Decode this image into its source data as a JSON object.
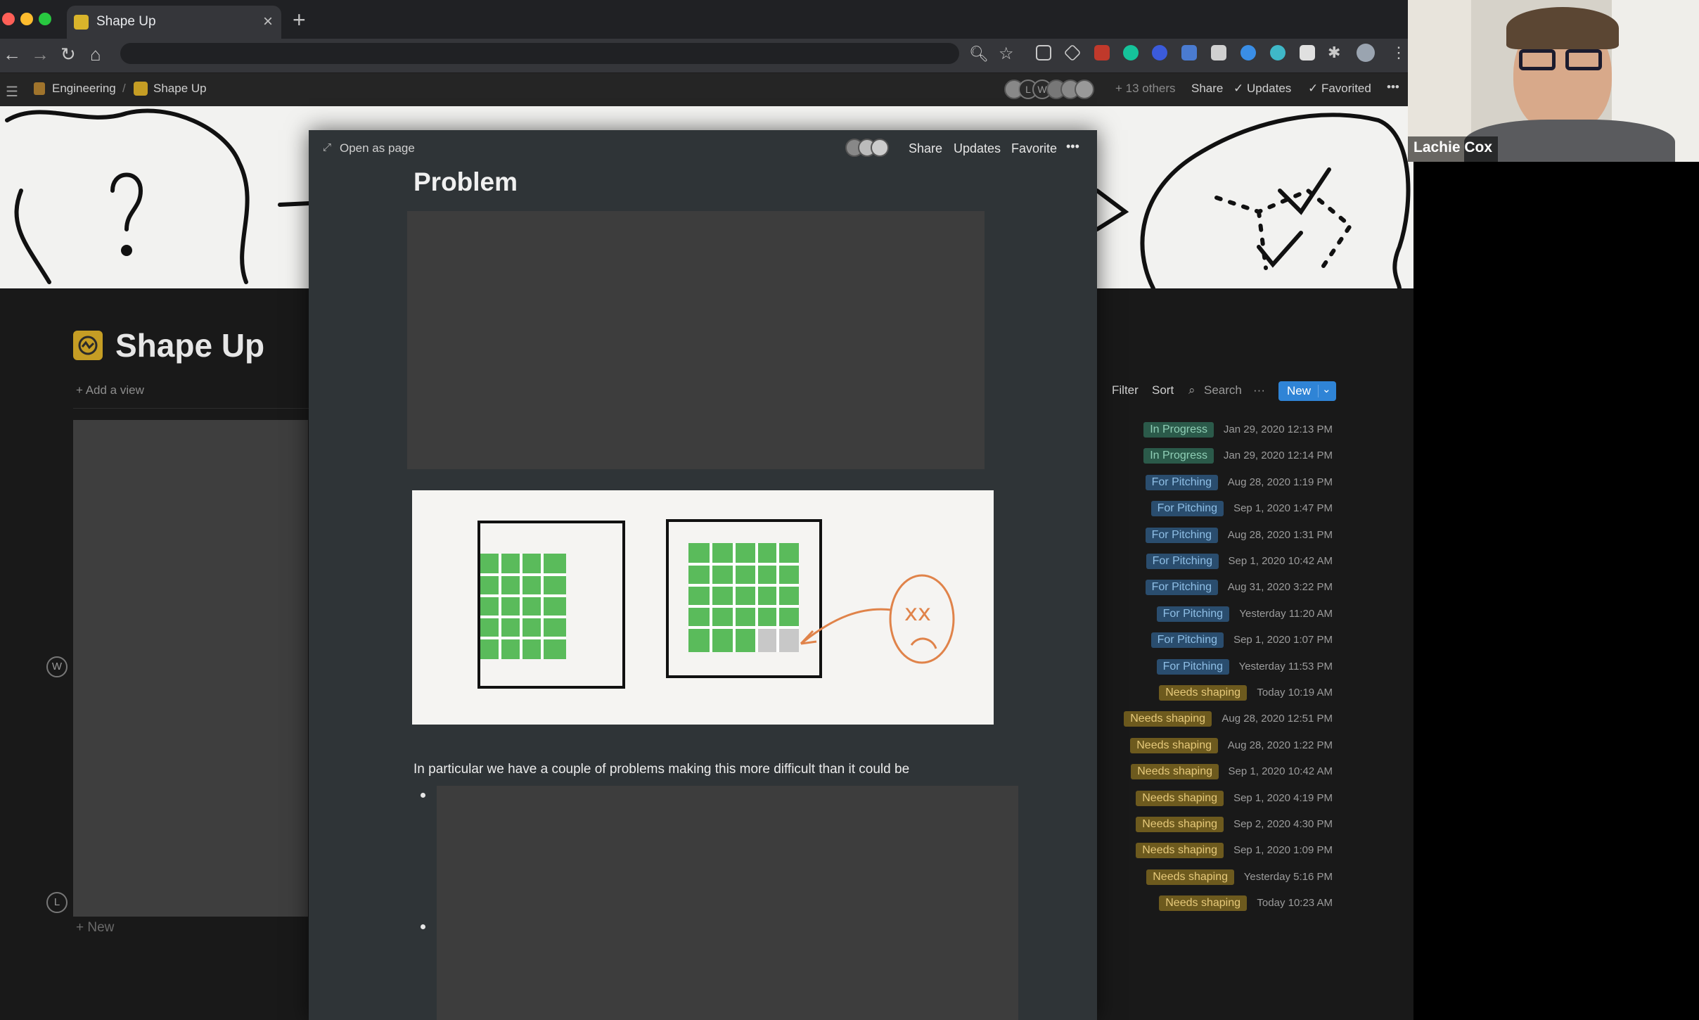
{
  "browser": {
    "tab_title": "Shape Up",
    "tab_close": "×",
    "new_tab": "+"
  },
  "notion_topbar": {
    "breadcrumb": [
      "Engineering",
      "Shape Up"
    ],
    "others": "+ 13 others",
    "share": "Share",
    "updates": "✓ Updates",
    "favorited": "✓ Favorited",
    "more": "•••"
  },
  "page": {
    "title": "Shape Up",
    "add_view": "+  Add a view",
    "new_item": "+   New",
    "avatars": [
      "W",
      "L"
    ]
  },
  "board_toolbar": {
    "filter": "Filter",
    "sort": "Sort",
    "search": "Search",
    "more": "···",
    "new": "New"
  },
  "rows": [
    {
      "status": "In Progress",
      "date": "Jan 29, 2020 12:13 PM"
    },
    {
      "status": "In Progress",
      "date": "Jan 29, 2020 12:14 PM"
    },
    {
      "status": "For Pitching",
      "date": "Aug 28, 2020 1:19 PM"
    },
    {
      "status": "For Pitching",
      "date": "Sep 1, 2020 1:47 PM"
    },
    {
      "status": "For Pitching",
      "date": "Aug 28, 2020 1:31 PM"
    },
    {
      "status": "For Pitching",
      "date": "Sep 1, 2020 10:42 AM"
    },
    {
      "status": "For Pitching",
      "date": "Aug 31, 2020 3:22 PM"
    },
    {
      "status": "For Pitching",
      "date": "Yesterday 11:20 AM"
    },
    {
      "status": "For Pitching",
      "date": "Sep 1, 2020 1:07 PM"
    },
    {
      "status": "For Pitching",
      "date": "Yesterday 11:53 PM"
    },
    {
      "status": "Needs shaping",
      "date": "Today 10:19 AM"
    },
    {
      "status": "Needs shaping",
      "date": "Aug 28, 2020 12:51 PM"
    },
    {
      "status": "Needs shaping",
      "date": "Aug 28, 2020 1:22 PM"
    },
    {
      "status": "Needs shaping",
      "date": "Sep 1, 2020 10:42 AM"
    },
    {
      "status": "Needs shaping",
      "date": "Sep 1, 2020 4:19 PM"
    },
    {
      "status": "Needs shaping",
      "date": "Sep 2, 2020 4:30 PM"
    },
    {
      "status": "Needs shaping",
      "date": "Sep 1, 2020 1:09 PM"
    },
    {
      "status": "Needs shaping",
      "date": "Yesterday 5:16 PM"
    },
    {
      "status": "Needs shaping",
      "date": "Today 10:23 AM"
    }
  ],
  "status_colors": {
    "In Progress": {
      "bg": "#2b5a4a",
      "fg": "#8fcfb6"
    },
    "For Pitching": {
      "bg": "#2a4d6e",
      "fg": "#8fbfe6"
    },
    "Needs shaping": {
      "bg": "#6d5a1e",
      "fg": "#e6c97a"
    }
  },
  "modal": {
    "open_as_page": "Open as page",
    "share": "Share",
    "updates": "Updates",
    "favorite": "Favorite",
    "more": "•••",
    "title": "Problem",
    "paragraph": "In particular we have a couple of problems making this more difficult than it could be"
  },
  "webcam": {
    "name": "Lachie Cox"
  },
  "colors": {
    "accent_blue": "#2f84d6",
    "page_icon": "#c59d24"
  }
}
